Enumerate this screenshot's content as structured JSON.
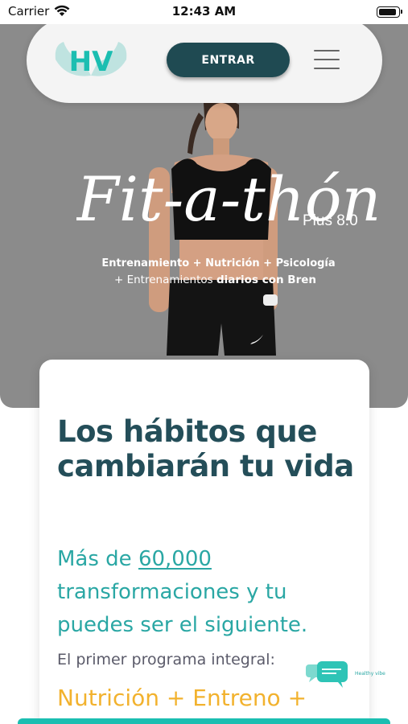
{
  "status_bar": {
    "carrier": "Carrier",
    "time": "12:43 AM"
  },
  "nav": {
    "logo_text": "HV",
    "enter_label": "ENTRAR",
    "menu_icon": "hamburger-icon"
  },
  "hero": {
    "title": "Fit-a-thón",
    "plus": "Plus 8.0",
    "subtitle_line1": "Entrenamiento + Nutrición + Psicología",
    "subtitle_line2_prefix": "+ Entrenamientos ",
    "subtitle_line2_bold": "diarios con Bren",
    "carousel_pages": 4,
    "carousel_active": 1
  },
  "card": {
    "title": "Los hábitos que cambiarán tu vida",
    "subtitle_prefix": "Más de ",
    "subtitle_count": "60,000",
    "subtitle_suffix": " transformaciones y tu puedes ser el siguiente.",
    "description": "El primer programa integral:",
    "nutrition_line": "Nutrición + Entreno +"
  },
  "chat": {
    "label": "Healthy vibe",
    "icon": "chat-bubble-icon"
  },
  "colors": {
    "brand_dark": "#1f4a52",
    "title_dark": "#244e59",
    "accent_teal": "#2aa7a4",
    "accent_yellow": "#f2b22e",
    "hero_bg": "#8b8b8b"
  }
}
